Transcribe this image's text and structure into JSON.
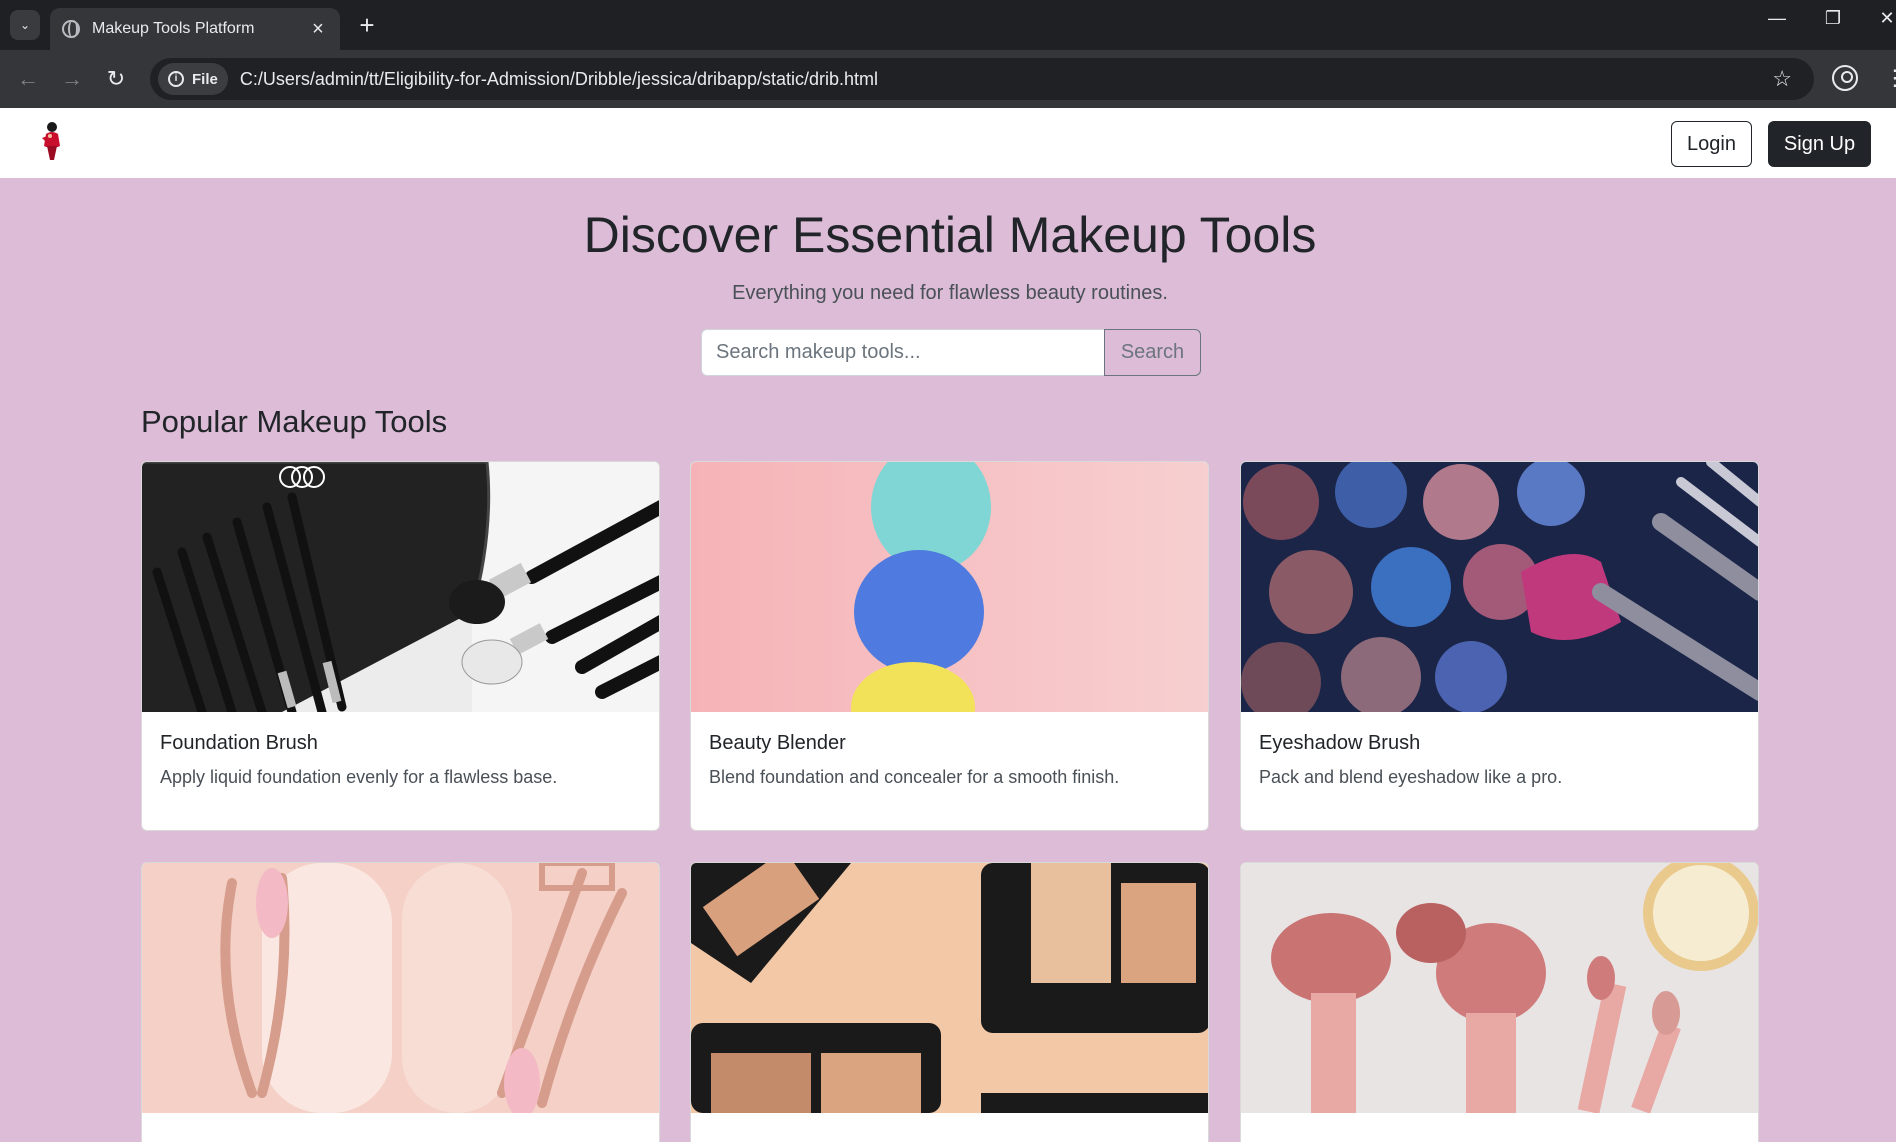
{
  "browser": {
    "tab_title": "Makeup Tools Platform",
    "new_tab_label": "+",
    "url_chip": "File",
    "url": "C:/Users/admin/tt/Eligibility-for-Admission/Dribble/jessica/dribapp/static/drib.html",
    "icons": [
      "globe-icon",
      "close-icon",
      "back-icon",
      "forward-icon",
      "reload-icon",
      "info-icon",
      "star-icon",
      "profile-icon",
      "kebab-icon",
      "minimize-icon",
      "restore-icon"
    ]
  },
  "navbar": {
    "login_label": "Login",
    "signup_label": "Sign Up"
  },
  "hero": {
    "title": "Discover Essential Makeup Tools",
    "subtitle": "Everything you need for flawless beauty routines.",
    "search_placeholder": "Search makeup tools...",
    "search_button": "Search"
  },
  "section": {
    "title": "Popular Makeup Tools"
  },
  "cards": [
    {
      "title": "Foundation Brush",
      "text": "Apply liquid foundation evenly for a flawless base."
    },
    {
      "title": "Beauty Blender",
      "text": "Blend foundation and concealer for a smooth finish."
    },
    {
      "title": "Eyeshadow Brush",
      "text": "Pack and blend eyeshadow like a pro."
    }
  ],
  "colors": {
    "page_background": "#dcbcd6",
    "dark_button": "#212529",
    "browser_chrome": "#35363a"
  }
}
